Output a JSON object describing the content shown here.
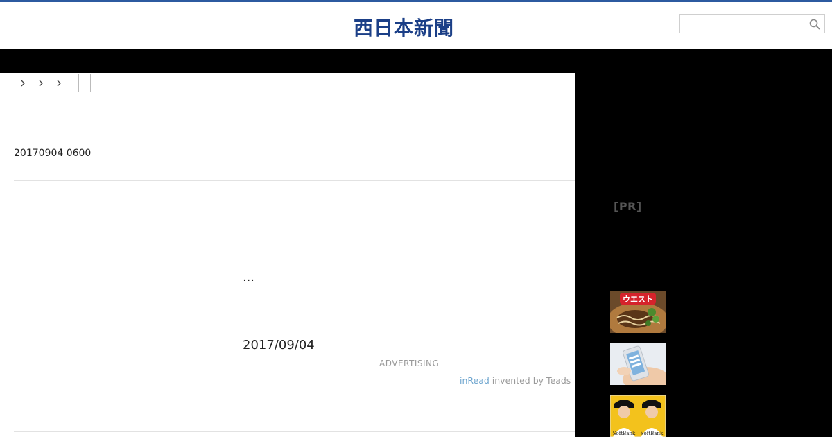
{
  "header": {
    "logo_text": "西日本新聞",
    "brand_color": "#1b3f87",
    "accent_line_color": "#2c5aa0",
    "search": {
      "value": "",
      "placeholder": "",
      "icon": "search-icon"
    }
  },
  "breadcrumb": {
    "separators": 3,
    "icon": "chevron-right-icon"
  },
  "article": {
    "dateline": "20170904 0600",
    "body_excerpt": "…",
    "published_date": "2017/09/04"
  },
  "ad": {
    "label": "ADVERTISING",
    "brand": "inRead",
    "tagline": " invented by Teads"
  },
  "sidebar": {
    "pr_label": "[PR]",
    "thumbnails": [
      {
        "icon": "noodle-ad-thumbnail",
        "badge": "ウエスト"
      },
      {
        "icon": "smartphone-ad-thumbnail"
      },
      {
        "icon": "baseball-players-ad-thumbnail",
        "caption_left": "SoftBank",
        "caption_right": "SoftBank"
      }
    ]
  }
}
